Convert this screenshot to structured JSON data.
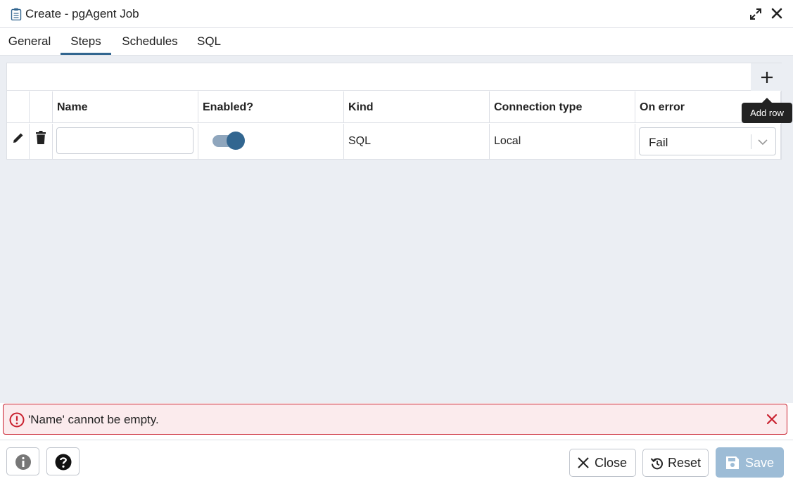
{
  "window": {
    "title": "Create - pgAgent Job"
  },
  "tabs": [
    {
      "label": "General"
    },
    {
      "label": "Steps"
    },
    {
      "label": "Schedules"
    },
    {
      "label": "SQL"
    }
  ],
  "active_tab": "Steps",
  "grid": {
    "columns": [
      "Name",
      "Enabled?",
      "Kind",
      "Connection type",
      "On error"
    ],
    "rows": [
      {
        "name": "",
        "enabled": true,
        "kind": "SQL",
        "connection_type": "Local",
        "on_error": "Fail"
      }
    ],
    "add_tooltip": "Add row"
  },
  "error": {
    "message": "'Name' cannot be empty."
  },
  "footer": {
    "close_label": "Close",
    "reset_label": "Reset",
    "save_label": "Save"
  },
  "colors": {
    "accent": "#326690",
    "error": "#c9202e",
    "save_disabled": "#9dbcd6"
  }
}
